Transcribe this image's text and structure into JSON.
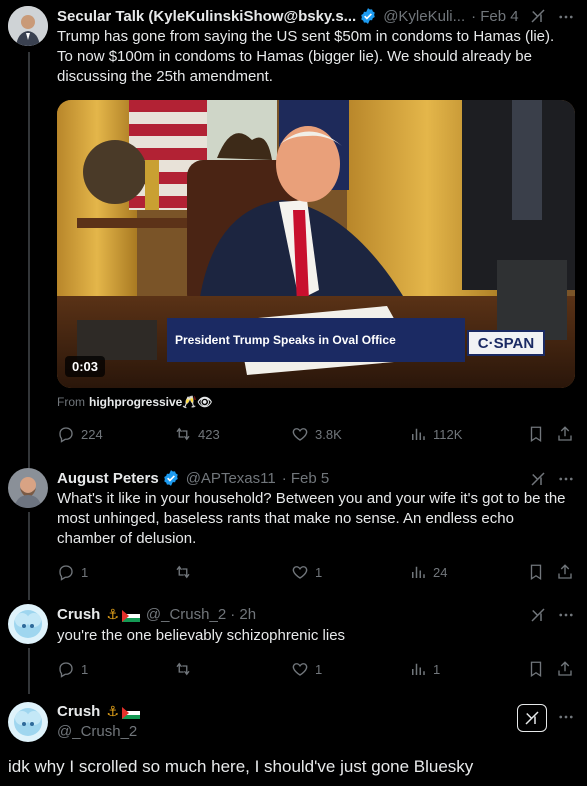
{
  "tweets": [
    {
      "display_name": "Secular Talk (KyleKulinskiShow@bsky.s...",
      "handle": "@KyleKuli...",
      "date": "· Feb 4",
      "text": "Trump has gone from saying the US sent $50m in condoms to Hamas (lie). To now $100m in condoms to Hamas (bigger lie). We should already be discussing the 25th amendment.",
      "video": {
        "lower_third": "President Trump Speaks in Oval Office",
        "network": "C·SPAN",
        "duration": "0:03"
      },
      "from_prefix": "From",
      "from_user": "highprogressive🥂👁",
      "stats": {
        "replies": "224",
        "reposts": "423",
        "likes": "3.8K",
        "views": "112K"
      }
    },
    {
      "display_name": "August Peters",
      "handle": "@APTexas11",
      "date": "· Feb 5",
      "text": "What's it like in your household? Between you and your wife it's got to be the most unhinged, baseless rants that make no sense. An endless echo chamber of delusion.",
      "stats": {
        "replies": "1",
        "reposts": "",
        "likes": "1",
        "views": "24"
      }
    },
    {
      "display_name": "Crush",
      "handle": "@_Crush_2",
      "date": "· 2h",
      "text": "you're the one believably schizophrenic lies",
      "stats": {
        "replies": "1",
        "reposts": "",
        "likes": "1",
        "views": "1"
      }
    },
    {
      "display_name": "Crush",
      "handle": "@_Crush_2",
      "text": "idk why I scrolled so much here, I should've just gone Bluesky"
    }
  ],
  "colors": {
    "background": "#000000",
    "text": "#e7e9ea",
    "muted": "#71767b",
    "verified": "#1d9bf0",
    "thread_line": "#333639"
  },
  "icons": [
    "verified-icon",
    "grok-icon",
    "more-icon",
    "reply-icon",
    "repost-icon",
    "like-icon",
    "views-icon",
    "bookmark-icon",
    "share-icon",
    "eye-icon"
  ]
}
